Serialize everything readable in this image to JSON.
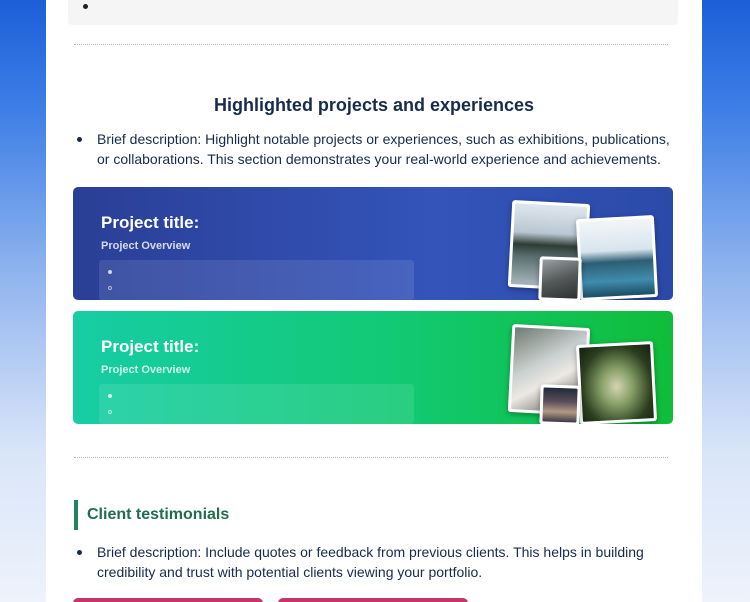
{
  "section": {
    "title": "Highlighted projects and experiences",
    "description": "Brief description: Highlight notable projects or experiences, such as exhibitions, publications, or collaborations. This section demonstrates your real-world experience and achievements."
  },
  "projects": [
    {
      "title": "Project title:",
      "overview": "Project Overview",
      "color": "#3454ba"
    },
    {
      "title": "Project title:",
      "overview": "Project Overview",
      "color": "#12c973"
    }
  ],
  "testimonials": {
    "title": "Client testimonials",
    "description": "Brief description: Include quotes or feedback from previous clients. This helps in building credibility and trust with potential clients viewing your portfolio.",
    "accent_color": "#1f845a"
  }
}
